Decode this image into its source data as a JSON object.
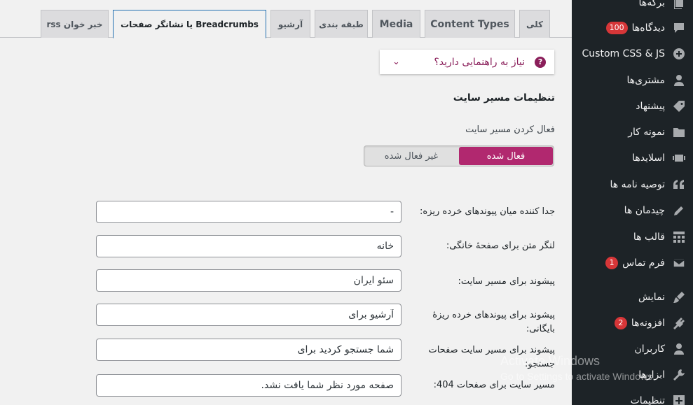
{
  "tabs": [
    {
      "label": "کلی"
    },
    {
      "label": "Content Types"
    },
    {
      "label": "Media"
    },
    {
      "label": "طبقه بندی"
    },
    {
      "label": "آرشیو"
    },
    {
      "label": "Breadcrumbs یا نشانگر صفحات"
    },
    {
      "label": "خبر خوان rss"
    }
  ],
  "help": {
    "label": "نیاز به راهنمایی دارید؟",
    "icon": "question-icon"
  },
  "section": {
    "title": "تنظیمات مسیر سایت",
    "enable_label": "فعال کردن مسیر سایت",
    "toggle": {
      "on": "فعال شده",
      "off": "غیر فعال شده",
      "selected": "فعال شده"
    }
  },
  "fields": [
    {
      "label": "جدا کننده میان پیوندهای خرده ریزه:",
      "value": "-"
    },
    {
      "label": "لنگر متن برای صفحهٔ خانگی:",
      "value": "خانه"
    },
    {
      "label": "پیشوند برای مسیر سایت:",
      "value": "سئو ایران"
    },
    {
      "label": "پیشوند برای پیوندهای خرده ریزهٔ بایگانی:",
      "value": "آرشیو برای"
    },
    {
      "label": "پیشوند برای مسیر سایت صفحات جستجو:",
      "value": "شما جستجو کردید برای"
    },
    {
      "label": "مسیر سایت برای صفحات 404:",
      "value": "صفحه مورد نظر شما یافت نشد."
    }
  ],
  "sidebar": {
    "items": [
      {
        "label": "برگه‌ها",
        "icon": "pages-icon"
      },
      {
        "label": "دیدگاه‌ها",
        "icon": "comments-icon",
        "badge": "100"
      },
      {
        "label": "Custom CSS & JS",
        "icon": "plus-circle-icon"
      },
      {
        "label": "مشتری‌ها",
        "icon": "user-icon"
      },
      {
        "label": "پیشنهاد",
        "icon": "tag-icon"
      },
      {
        "label": "نمونه کار",
        "icon": "folder-icon"
      },
      {
        "label": "اسلایدها",
        "icon": "slides-icon"
      },
      {
        "label": "توصیه نامه ها",
        "icon": "quote-icon"
      },
      {
        "label": "چیدمان ها",
        "icon": "pencil-icon"
      },
      {
        "label": "قالب ها",
        "icon": "grid-icon"
      },
      {
        "label": "فرم تماس",
        "icon": "mail-icon",
        "badge": "1"
      },
      {
        "label": "نمایش",
        "icon": "brush-icon"
      },
      {
        "label": "افزونه‌ها",
        "icon": "plugin-icon",
        "badge": "2"
      },
      {
        "label": "کاربران",
        "icon": "user-icon"
      },
      {
        "label": "ابزارها",
        "icon": "wrench-icon"
      },
      {
        "label": "تنظیمات",
        "icon": "settings-icon"
      }
    ]
  },
  "watermark": {
    "line1": "Activate Windows",
    "line2": "Go to Settings to activate Windows."
  },
  "colors": {
    "accent": "#b1286f",
    "sidebar_bg": "#1d2327",
    "tab_active_border": "#2271b1",
    "badge": "#d63638"
  }
}
